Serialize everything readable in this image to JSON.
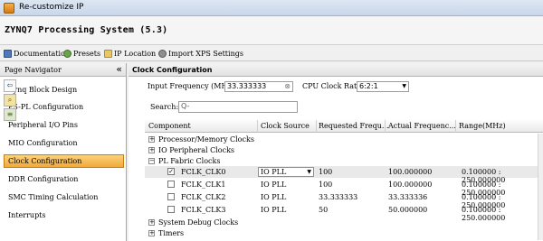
{
  "window": {
    "title": "Re-customize IP"
  },
  "header": {
    "title": "ZYNQ7 Processing System (5.3)"
  },
  "toolbar": {
    "items": [
      {
        "label": "Documentation",
        "icon": "book-icon"
      },
      {
        "label": "Presets",
        "icon": "presets-icon"
      },
      {
        "label": "IP Location",
        "icon": "folder-icon"
      },
      {
        "label": "Import XPS Settings",
        "icon": "gear-icon"
      }
    ]
  },
  "nav": {
    "title": "Page Navigator",
    "collapse_label": "«",
    "items": [
      {
        "label": "Zynq Block Design"
      },
      {
        "label": "PS-PL Configuration"
      },
      {
        "label": "Peripheral I/O Pins"
      },
      {
        "label": "MIO Configuration"
      },
      {
        "label": "Clock Configuration"
      },
      {
        "label": "DDR Configuration"
      },
      {
        "label": "SMC Timing Calculation"
      },
      {
        "label": "Interrupts"
      }
    ],
    "selected_index": 4
  },
  "panel": {
    "title": "Clock Configuration",
    "input_frequency_label": "Input Frequency (MHz)",
    "input_frequency_value": "33.333333",
    "cpu_ratio_label": "CPU Clock Ratio",
    "cpu_ratio_value": "6:2:1",
    "search_label": "Search:",
    "search_placeholder": "Q-"
  },
  "table": {
    "headers": [
      "Component",
      "Clock Source",
      "Requested Frequ...",
      "Actual Frequenc...",
      "Range(MHz)"
    ],
    "groups": [
      {
        "label": "Processor/Memory Clocks",
        "toggle": "+"
      },
      {
        "label": "IO Peripheral Clocks",
        "toggle": "+"
      },
      {
        "label": "PL Fabric Clocks",
        "toggle": "−"
      }
    ],
    "rows": [
      {
        "name": "FCLK_CLK0",
        "checked": "✓",
        "source": "IO PLL",
        "requested": "100",
        "actual": "100.000000",
        "range": "0.100000 : 250.000000"
      },
      {
        "name": "FCLK_CLK1",
        "checked": "",
        "source": "IO PLL",
        "requested": "100",
        "actual": "100.000000",
        "range": "0.100000 : 250.000000"
      },
      {
        "name": "FCLK_CLK2",
        "checked": "",
        "source": "IO PLL",
        "requested": "33.333333",
        "actual": "33.333336",
        "range": "0.100000 : 250.000000"
      },
      {
        "name": "FCLK_CLK3",
        "checked": "",
        "source": "IO PLL",
        "requested": "50",
        "actual": "50.000000",
        "range": "0.100000 : 250.000000"
      }
    ],
    "footer_groups": [
      {
        "label": "System Debug Clocks",
        "toggle": "+"
      },
      {
        "label": "Timers",
        "toggle": "+"
      }
    ],
    "dropdown_arrow": "▼"
  },
  "colors": {
    "selection": "#f2a93b",
    "header_bg": "#e2e2e2"
  }
}
